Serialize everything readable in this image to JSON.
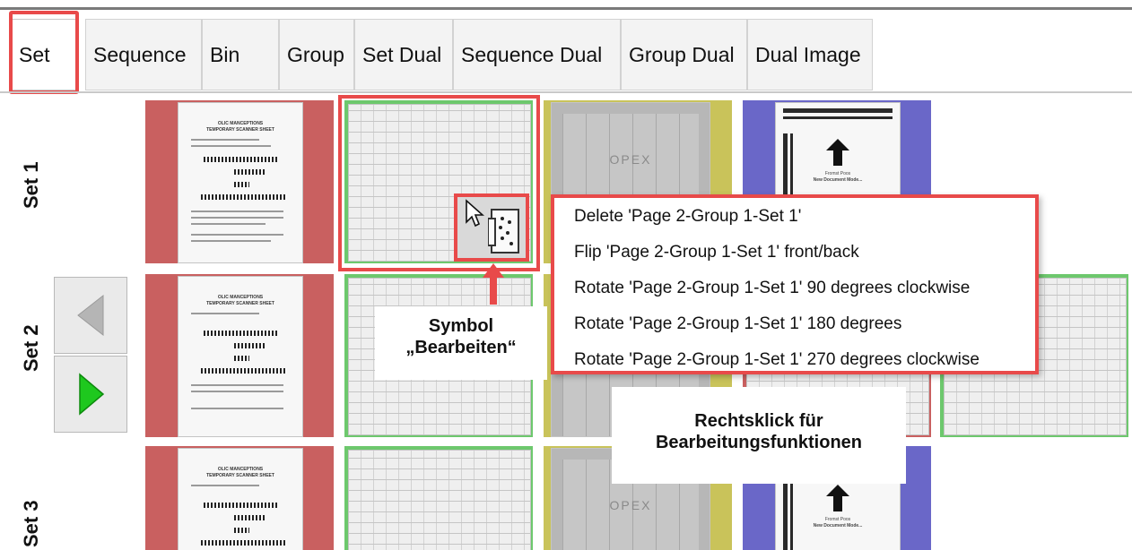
{
  "tabs": [
    "Set",
    "Sequence",
    "Bin",
    "Group",
    "Set Dual",
    "Sequence Dual",
    "Group Dual",
    "Dual Image"
  ],
  "active_tab": "Set",
  "rows": [
    "Set 1",
    "Set 2",
    "Set 3"
  ],
  "colors": {
    "highlight_red": "#e84a4a",
    "col1_bg": "#c96060",
    "col2_bg": "#6dc86d",
    "col3_bg": "#c9c35a",
    "col4_bg": "#6a67c8",
    "nav_arrow_right": "#1ec81e"
  },
  "thumb_text": {
    "opex": "OPEX",
    "form_title": "OLIC MANCEPTIONS",
    "form_subtitle": "TEMPORARY SCANNER SHEET",
    "cover_line1": "Fromst Poos",
    "cover_line2": "New Document Mode..."
  },
  "context_menu": [
    "Delete 'Page 2-Group 1-Set 1'",
    "Flip 'Page 2-Group 1-Set 1' front/back",
    "Rotate 'Page 2-Group 1-Set 1' 90 degrees clockwise",
    "Rotate 'Page 2-Group 1-Set 1' 180 degrees",
    "Rotate 'Page 2-Group 1-Set 1' 270 degrees clockwise"
  ],
  "callouts": {
    "edit_symbol_line1": "Symbol",
    "edit_symbol_line2": "„Bearbeiten“",
    "right_click_line1": "Rechtsklick für",
    "right_click_line2": "Bearbeitungsfunktionen"
  },
  "icons": {
    "nav_prev": "triangle-left-icon",
    "nav_next": "triangle-right-icon",
    "edit": "edit-document-icon",
    "cursor": "mouse-pointer-icon",
    "upload_arrow": "up-arrow-icon"
  }
}
